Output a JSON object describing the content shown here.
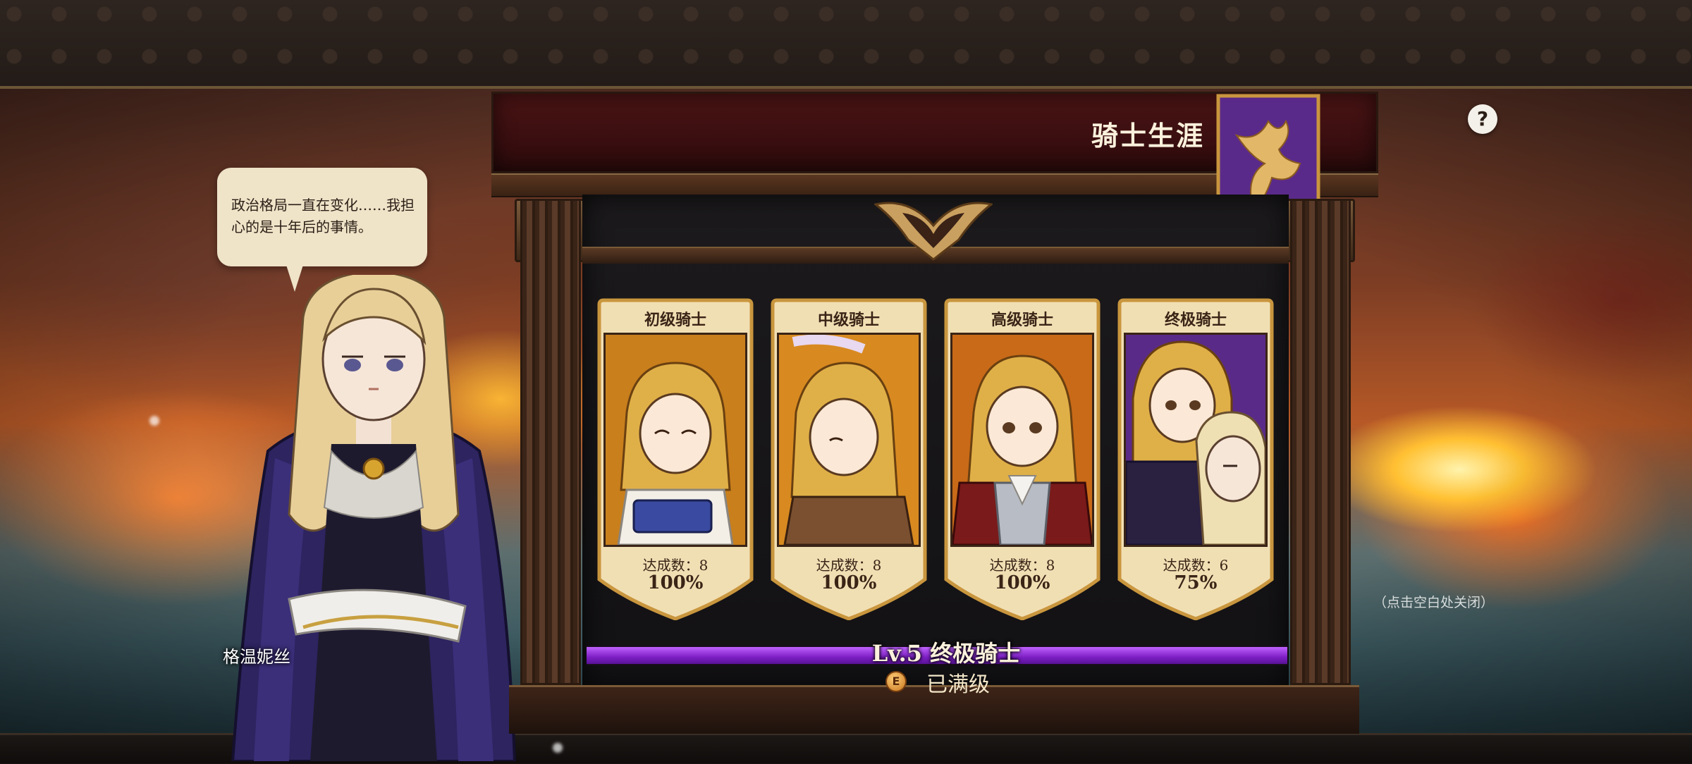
{
  "dialog": {
    "speech_text": "政治格局一直在变化……我担心的是十年后的事情。",
    "speaker_name": "格温妮丝"
  },
  "panel": {
    "title": "骑士生涯",
    "help_label": "?",
    "close_hint": "（点击空白处关闭）"
  },
  "cards": [
    {
      "title": "初级骑士",
      "count_label": "达成数：8",
      "percent": "100%",
      "art_bg": "#c97f1c"
    },
    {
      "title": "中级骑士",
      "count_label": "达成数：8",
      "percent": "100%",
      "art_bg": "#d88a20"
    },
    {
      "title": "高级骑士",
      "count_label": "达成数：8",
      "percent": "100%",
      "art_bg": "#c96a18"
    },
    {
      "title": "终极骑士",
      "count_label": "达成数：6",
      "percent": "75%",
      "art_bg": "#5a2a88"
    }
  ],
  "progress": {
    "level_label": "Lv.5 终极骑士",
    "fill_fraction": 1.0,
    "coin_icon": "E",
    "max_label": "已满级"
  },
  "colors": {
    "accent_purple": "#7d1fc4",
    "card_parchment": "#f1dfb4",
    "card_border_gold": "#c9963e",
    "header_crimson": "#4a1414"
  }
}
